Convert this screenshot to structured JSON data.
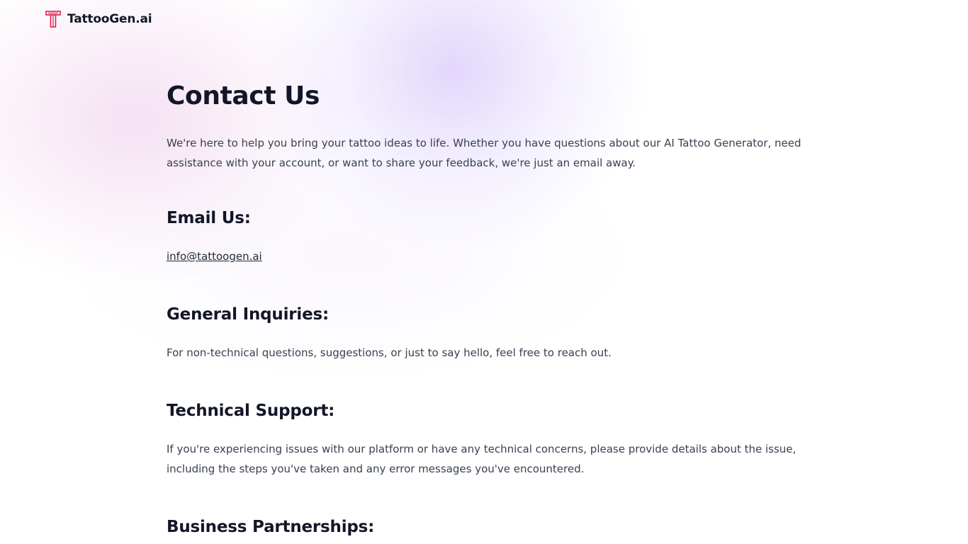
{
  "header": {
    "brand_name": "TattooGen.ai",
    "logo_icon": "tattoo-t-logo-icon",
    "logo_color": "#e11d48"
  },
  "main": {
    "title": "Contact Us",
    "intro": "We're here to help you bring your tattoo ideas to life. Whether you have questions about our AI Tattoo Generator, need assistance with your account, or want to share your feedback, we're just an email away.",
    "sections": {
      "email": {
        "heading": "Email Us:",
        "link_text": "info@tattoogen.ai"
      },
      "general": {
        "heading": "General Inquiries:",
        "body": "For non-technical questions, suggestions, or just to say hello, feel free to reach out."
      },
      "technical": {
        "heading": "Technical Support:",
        "body": "If you're experiencing issues with our platform or have any technical concerns, please provide details about the issue, including the steps you've taken and any error messages you've encountered."
      },
      "business": {
        "heading": "Business Partnerships:"
      }
    }
  },
  "colors": {
    "heading": "#131628",
    "body_text": "#374151",
    "background_glow_pink": "#ecc8e8",
    "background_glow_purple": "#d6c6fa"
  }
}
